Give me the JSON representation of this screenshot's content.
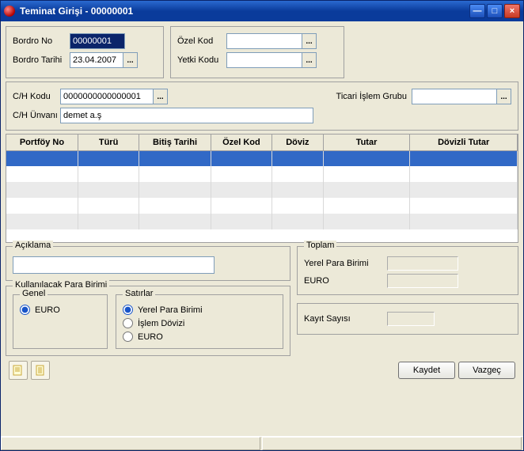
{
  "window": {
    "title": "Teminat Girişi - 00000001"
  },
  "top_left": {
    "bordro_no_label": "Bordro No",
    "bordro_no_value": "00000001",
    "bordro_tarihi_label": "Bordro Tarihi",
    "bordro_tarihi_value": "23.04.2007"
  },
  "top_right": {
    "ozel_kod_label": "Özel Kod",
    "ozel_kod_value": "",
    "yetki_kodu_label": "Yetki Kodu",
    "yetki_kodu_value": ""
  },
  "ch": {
    "kodu_label": "C/H Kodu",
    "kodu_value": "0000000000000001",
    "unvani_label": "C/H Ünvanı",
    "unvani_value": "demet a.ş",
    "ticari_islem_label": "Ticari İşlem Grubu",
    "ticari_islem_value": ""
  },
  "grid": {
    "cols": [
      "Portföy No",
      "Türü",
      "Bitiş Tarihi",
      "Özel Kod",
      "Döviz",
      "Tutar",
      "Dövizli Tutar"
    ]
  },
  "aciklama": {
    "label": "Açıklama",
    "value": ""
  },
  "para_birimi": {
    "legend": "Kullanılacak Para Birimi",
    "genel_legend": "Genel",
    "genel_euro": "EURO",
    "satirlar_legend": "Satırlar",
    "opt_yerel": "Yerel Para Birimi",
    "opt_islem": "İşlem Dövizi",
    "opt_euro": "EURO"
  },
  "toplam": {
    "legend": "Toplam",
    "yerel_label": "Yerel Para Birimi",
    "euro_label": "EURO"
  },
  "kayit": {
    "label": "Kayıt Sayısı"
  },
  "buttons": {
    "kaydet": "Kaydet",
    "vazgec": "Vazgeç"
  },
  "ellipsis": "..."
}
